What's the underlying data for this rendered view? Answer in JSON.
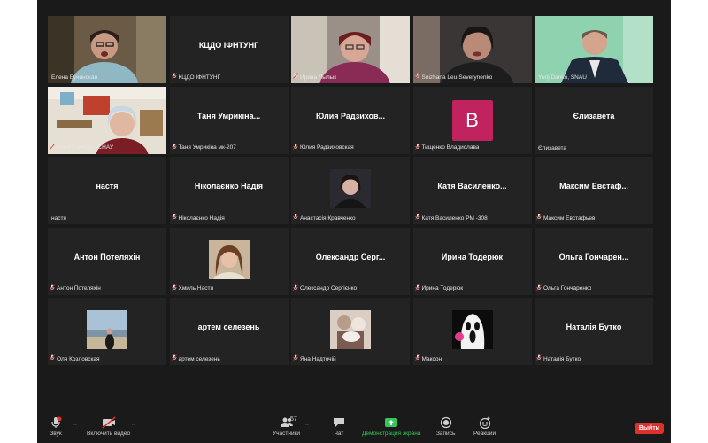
{
  "tiles": [
    {
      "kind": "video",
      "label": "Елена Бучинская",
      "muted": false
    },
    {
      "kind": "name",
      "name": "КЦДО ІФНТУНГ",
      "label": "КЦДО ІФНТУНГ",
      "muted": true
    },
    {
      "kind": "video",
      "label": "Ирина Лылык",
      "muted": true
    },
    {
      "kind": "video",
      "label": "Snizhana Leu-Severynenko",
      "muted": true
    },
    {
      "kind": "video",
      "label": "Yurij Danko, SNAU",
      "muted": false
    },
    {
      "kind": "video",
      "label": "Анна Глуходід_СНАУ",
      "muted": true
    },
    {
      "kind": "name",
      "name": "Таня Умрикіна...",
      "label": "Таня Умрикіна мк-207",
      "muted": true
    },
    {
      "kind": "name",
      "name": "Юлия Радзихов...",
      "label": "Юлия Радзиховская",
      "muted": true
    },
    {
      "kind": "avatar",
      "letter": "В",
      "label": "Тищенко Владислава",
      "muted": true
    },
    {
      "kind": "name",
      "name": "Єлизавета",
      "label": "Єлизавета",
      "muted": false
    },
    {
      "kind": "name",
      "name": "настя",
      "label": "настя",
      "muted": false
    },
    {
      "kind": "name",
      "name": "Ніколаєнко Надія",
      "label": "Ніколаєнко Надія",
      "muted": true
    },
    {
      "kind": "thumb",
      "label": "Анастасія Кравченко",
      "muted": true
    },
    {
      "kind": "name",
      "name": "Катя Василенко...",
      "label": "Катя Василенко РМ -308",
      "muted": true
    },
    {
      "kind": "name",
      "name": "Максим Евстаф...",
      "label": "Максим Евстафьев",
      "muted": true
    },
    {
      "kind": "name",
      "name": "Антон Потеляхін",
      "label": "Антон Потеляхін",
      "muted": true
    },
    {
      "kind": "thumb",
      "label": "Хмиль Настя",
      "muted": true
    },
    {
      "kind": "name",
      "name": "Олександр Серг...",
      "label": "Олександр Сергієнко",
      "muted": true
    },
    {
      "kind": "name",
      "name": "Ирина Тодерюк",
      "label": "Ирина Тодерюк",
      "muted": true
    },
    {
      "kind": "name",
      "name": "Ольга Гончарен...",
      "label": "Ольга Гончаренко",
      "muted": true
    },
    {
      "kind": "thumb",
      "label": "Оля Козловская",
      "muted": true
    },
    {
      "kind": "name",
      "name": "артем селезень",
      "label": "артем селезень",
      "muted": true
    },
    {
      "kind": "thumb",
      "label": "Яна Надточій",
      "muted": true
    },
    {
      "kind": "thumb",
      "label": "Максон",
      "muted": true
    },
    {
      "kind": "name",
      "name": "Наталія Бутко",
      "label": "Наталія Бутко",
      "muted": true
    }
  ],
  "toolbar": {
    "audio": "Звук",
    "video": "Включить видео",
    "participants": "Участники",
    "participants_count": "57",
    "chat": "Чат",
    "share": "Демонстрация экрана",
    "record": "Запись",
    "reactions": "Реакции",
    "leave": "Выйти"
  },
  "colors": {
    "background": "#1a1a1a",
    "tile": "#232323",
    "active_speaker": "#c8e63a",
    "share": "#33c957",
    "leave": "#e0302d",
    "avatar": "#c0235e"
  }
}
